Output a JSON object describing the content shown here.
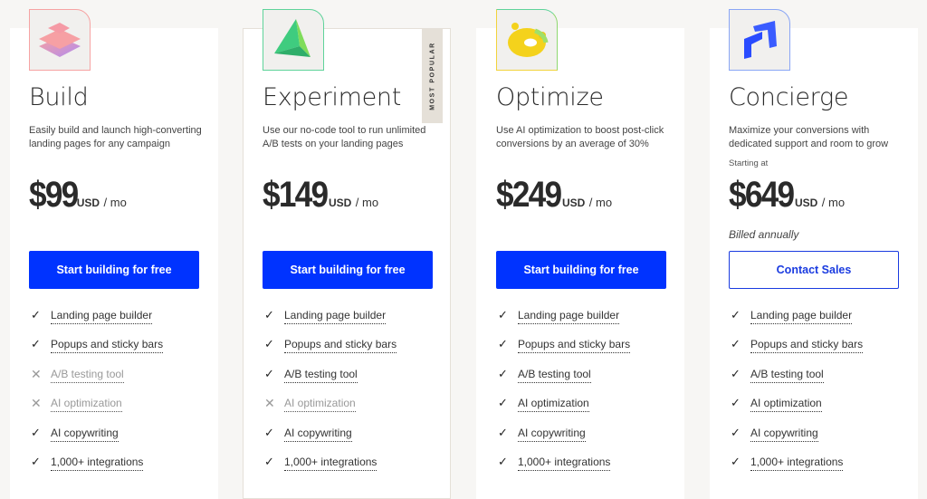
{
  "plans": [
    {
      "name": "Build",
      "icon": "layers-icon",
      "description": "Easily build and launch high-converting landing pages for any campaign",
      "starting_at": null,
      "price": "$99",
      "currency": "USD",
      "period": "/ mo",
      "billed": null,
      "cta": "Start building for free",
      "features": [
        {
          "label": "Landing page builder",
          "included": true
        },
        {
          "label": "Popups and sticky bars",
          "included": true
        },
        {
          "label": "A/B testing tool",
          "included": false
        },
        {
          "label": "AI optimization",
          "included": false
        },
        {
          "label": "AI copywriting",
          "included": true
        },
        {
          "label": "1,000+ integrations",
          "included": true
        }
      ]
    },
    {
      "name": "Experiment",
      "icon": "pyramid-icon",
      "badge": "MOST POPULAR",
      "description": "Use our no-code tool to run unlimited A/B tests on your landing pages",
      "starting_at": null,
      "price": "$149",
      "currency": "USD",
      "period": "/ mo",
      "billed": null,
      "cta": "Start building for free",
      "features": [
        {
          "label": "Landing page builder",
          "included": true
        },
        {
          "label": "Popups and sticky bars",
          "included": true
        },
        {
          "label": "A/B testing tool",
          "included": true
        },
        {
          "label": "AI optimization",
          "included": false
        },
        {
          "label": "AI copywriting",
          "included": true
        },
        {
          "label": "1,000+ integrations",
          "included": true
        }
      ]
    },
    {
      "name": "Optimize",
      "icon": "ring-icon",
      "description": "Use AI optimization to boost post-click conversions by an average of 30%",
      "starting_at": null,
      "price": "$249",
      "currency": "USD",
      "period": "/ mo",
      "billed": null,
      "cta": "Start building for free",
      "features": [
        {
          "label": "Landing page builder",
          "included": true
        },
        {
          "label": "Popups and sticky bars",
          "included": true
        },
        {
          "label": "A/B testing tool",
          "included": true
        },
        {
          "label": "AI optimization",
          "included": true
        },
        {
          "label": "AI copywriting",
          "included": true
        },
        {
          "label": "1,000+ integrations",
          "included": true
        }
      ]
    },
    {
      "name": "Concierge",
      "icon": "arrow-up-right-icon",
      "description": "Maximize your conversions with dedicated support and room to grow",
      "starting_at": "Starting at",
      "price": "$649",
      "currency": "USD",
      "period": "/ mo",
      "billed": "Billed annually",
      "cta": "Contact Sales",
      "features": [
        {
          "label": "Landing page builder",
          "included": true
        },
        {
          "label": "Popups and sticky bars",
          "included": true
        },
        {
          "label": "A/B testing tool",
          "included": true
        },
        {
          "label": "AI optimization",
          "included": true
        },
        {
          "label": "AI copywriting",
          "included": true
        },
        {
          "label": "1,000+ integrations",
          "included": true
        }
      ]
    }
  ],
  "marks": {
    "included": "✓",
    "excluded": "✕"
  },
  "colors": {
    "primary_button": "#0033ff",
    "outline_button": "#1a3be0",
    "badge_bg": "#e5e0d8",
    "page_bg": "#f7f6f4"
  }
}
